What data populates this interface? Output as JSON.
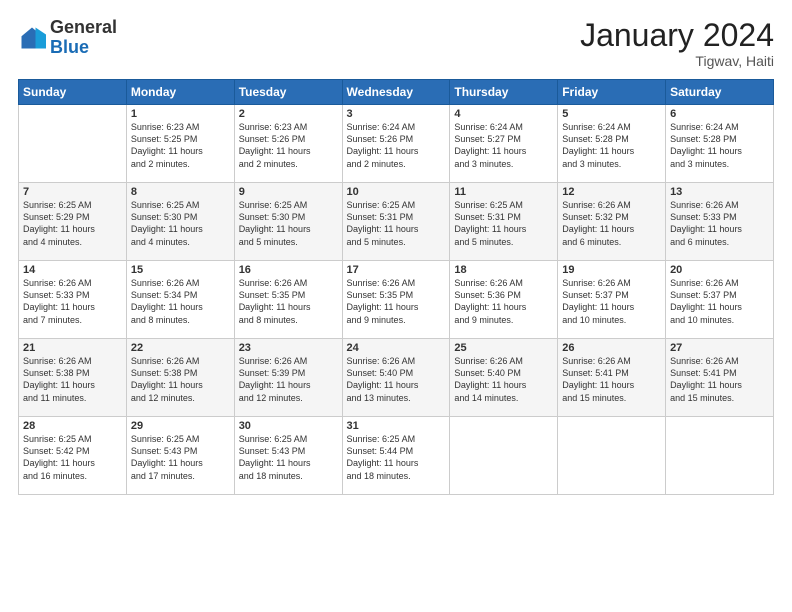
{
  "header": {
    "logo_general": "General",
    "logo_blue": "Blue",
    "month_title": "January 2024",
    "location": "Tigwav, Haiti"
  },
  "days_of_week": [
    "Sunday",
    "Monday",
    "Tuesday",
    "Wednesday",
    "Thursday",
    "Friday",
    "Saturday"
  ],
  "weeks": [
    [
      {
        "day": "",
        "content": ""
      },
      {
        "day": "1",
        "content": "Sunrise: 6:23 AM\nSunset: 5:25 PM\nDaylight: 11 hours\nand 2 minutes."
      },
      {
        "day": "2",
        "content": "Sunrise: 6:23 AM\nSunset: 5:26 PM\nDaylight: 11 hours\nand 2 minutes."
      },
      {
        "day": "3",
        "content": "Sunrise: 6:24 AM\nSunset: 5:26 PM\nDaylight: 11 hours\nand 2 minutes."
      },
      {
        "day": "4",
        "content": "Sunrise: 6:24 AM\nSunset: 5:27 PM\nDaylight: 11 hours\nand 3 minutes."
      },
      {
        "day": "5",
        "content": "Sunrise: 6:24 AM\nSunset: 5:28 PM\nDaylight: 11 hours\nand 3 minutes."
      },
      {
        "day": "6",
        "content": "Sunrise: 6:24 AM\nSunset: 5:28 PM\nDaylight: 11 hours\nand 3 minutes."
      }
    ],
    [
      {
        "day": "7",
        "content": "Sunrise: 6:25 AM\nSunset: 5:29 PM\nDaylight: 11 hours\nand 4 minutes."
      },
      {
        "day": "8",
        "content": "Sunrise: 6:25 AM\nSunset: 5:30 PM\nDaylight: 11 hours\nand 4 minutes."
      },
      {
        "day": "9",
        "content": "Sunrise: 6:25 AM\nSunset: 5:30 PM\nDaylight: 11 hours\nand 5 minutes."
      },
      {
        "day": "10",
        "content": "Sunrise: 6:25 AM\nSunset: 5:31 PM\nDaylight: 11 hours\nand 5 minutes."
      },
      {
        "day": "11",
        "content": "Sunrise: 6:25 AM\nSunset: 5:31 PM\nDaylight: 11 hours\nand 5 minutes."
      },
      {
        "day": "12",
        "content": "Sunrise: 6:26 AM\nSunset: 5:32 PM\nDaylight: 11 hours\nand 6 minutes."
      },
      {
        "day": "13",
        "content": "Sunrise: 6:26 AM\nSunset: 5:33 PM\nDaylight: 11 hours\nand 6 minutes."
      }
    ],
    [
      {
        "day": "14",
        "content": "Sunrise: 6:26 AM\nSunset: 5:33 PM\nDaylight: 11 hours\nand 7 minutes."
      },
      {
        "day": "15",
        "content": "Sunrise: 6:26 AM\nSunset: 5:34 PM\nDaylight: 11 hours\nand 8 minutes."
      },
      {
        "day": "16",
        "content": "Sunrise: 6:26 AM\nSunset: 5:35 PM\nDaylight: 11 hours\nand 8 minutes."
      },
      {
        "day": "17",
        "content": "Sunrise: 6:26 AM\nSunset: 5:35 PM\nDaylight: 11 hours\nand 9 minutes."
      },
      {
        "day": "18",
        "content": "Sunrise: 6:26 AM\nSunset: 5:36 PM\nDaylight: 11 hours\nand 9 minutes."
      },
      {
        "day": "19",
        "content": "Sunrise: 6:26 AM\nSunset: 5:37 PM\nDaylight: 11 hours\nand 10 minutes."
      },
      {
        "day": "20",
        "content": "Sunrise: 6:26 AM\nSunset: 5:37 PM\nDaylight: 11 hours\nand 10 minutes."
      }
    ],
    [
      {
        "day": "21",
        "content": "Sunrise: 6:26 AM\nSunset: 5:38 PM\nDaylight: 11 hours\nand 11 minutes."
      },
      {
        "day": "22",
        "content": "Sunrise: 6:26 AM\nSunset: 5:38 PM\nDaylight: 11 hours\nand 12 minutes."
      },
      {
        "day": "23",
        "content": "Sunrise: 6:26 AM\nSunset: 5:39 PM\nDaylight: 11 hours\nand 12 minutes."
      },
      {
        "day": "24",
        "content": "Sunrise: 6:26 AM\nSunset: 5:40 PM\nDaylight: 11 hours\nand 13 minutes."
      },
      {
        "day": "25",
        "content": "Sunrise: 6:26 AM\nSunset: 5:40 PM\nDaylight: 11 hours\nand 14 minutes."
      },
      {
        "day": "26",
        "content": "Sunrise: 6:26 AM\nSunset: 5:41 PM\nDaylight: 11 hours\nand 15 minutes."
      },
      {
        "day": "27",
        "content": "Sunrise: 6:26 AM\nSunset: 5:41 PM\nDaylight: 11 hours\nand 15 minutes."
      }
    ],
    [
      {
        "day": "28",
        "content": "Sunrise: 6:25 AM\nSunset: 5:42 PM\nDaylight: 11 hours\nand 16 minutes."
      },
      {
        "day": "29",
        "content": "Sunrise: 6:25 AM\nSunset: 5:43 PM\nDaylight: 11 hours\nand 17 minutes."
      },
      {
        "day": "30",
        "content": "Sunrise: 6:25 AM\nSunset: 5:43 PM\nDaylight: 11 hours\nand 18 minutes."
      },
      {
        "day": "31",
        "content": "Sunrise: 6:25 AM\nSunset: 5:44 PM\nDaylight: 11 hours\nand 18 minutes."
      },
      {
        "day": "",
        "content": ""
      },
      {
        "day": "",
        "content": ""
      },
      {
        "day": "",
        "content": ""
      }
    ]
  ]
}
